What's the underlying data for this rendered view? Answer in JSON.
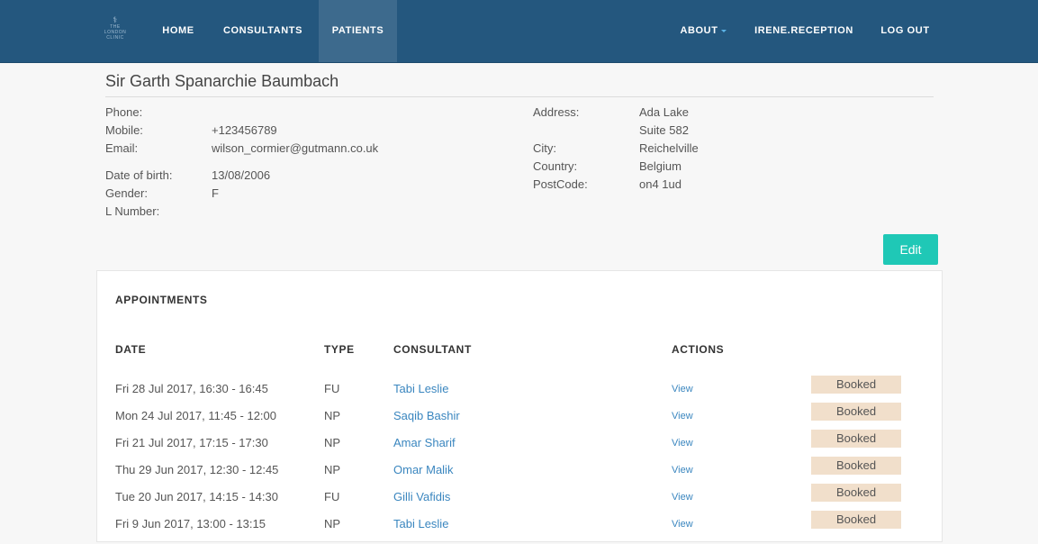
{
  "nav": {
    "logo": {
      "the": "THE",
      "line1": "LONDON",
      "line2": "CLINIC"
    },
    "home": "HOME",
    "consultants": "CONSULTANTS",
    "patients": "PATIENTS",
    "about": "ABOUT",
    "user": "IRENE.RECEPTION",
    "logout": "LOG OUT"
  },
  "patient": {
    "name": "Sir Garth Spanarchie Baumbach",
    "labels": {
      "phone": "Phone:",
      "mobile": "Mobile:",
      "email": "Email:",
      "dob": "Date of birth:",
      "gender": "Gender:",
      "lnumber": "L Number:",
      "address": "Address:",
      "city": "City:",
      "country": "Country:",
      "postcode": "PostCode:"
    },
    "phone": "",
    "mobile": "+123456789",
    "email": "wilson_cormier@gutmann.co.uk",
    "dob": "13/08/2006",
    "gender": "F",
    "lnumber": "",
    "address_line1": "Ada Lake",
    "address_line2": "Suite 582",
    "city": "Reichelville",
    "country": "Belgium",
    "postcode": "on4 1ud"
  },
  "edit_label": "Edit",
  "appointments": {
    "title": "APPOINTMENTS",
    "headers": {
      "date": "DATE",
      "type": "TYPE",
      "consultant": "CONSULTANT",
      "actions": "ACTIONS"
    },
    "rows": [
      {
        "date": "Fri 28 Jul 2017, 16:30 - 16:45",
        "type": "FU",
        "consultant": "Tabi Leslie",
        "action": "View",
        "status": "Booked"
      },
      {
        "date": "Mon 24 Jul 2017, 11:45 - 12:00",
        "type": "NP",
        "consultant": "Saqib Bashir",
        "action": "View",
        "status": "Booked"
      },
      {
        "date": "Fri 21 Jul 2017, 17:15 - 17:30",
        "type": "NP",
        "consultant": "Amar Sharif",
        "action": "View",
        "status": "Booked"
      },
      {
        "date": "Thu 29 Jun 2017, 12:30 - 12:45",
        "type": "NP",
        "consultant": "Omar Malik",
        "action": "View",
        "status": "Booked"
      },
      {
        "date": "Tue 20 Jun 2017, 14:15 - 14:30",
        "type": "FU",
        "consultant": "Gilli Vafidis",
        "action": "View",
        "status": "Booked"
      },
      {
        "date": "Fri 9 Jun 2017, 13:00 - 13:15",
        "type": "NP",
        "consultant": "Tabi Leslie",
        "action": "View",
        "status": "Booked"
      }
    ]
  },
  "colors": {
    "navbar": "#24577e",
    "active_tab": "#3d6a8d",
    "edit_button": "#1fc8b6",
    "link": "#3a86bf",
    "status_badge": "#f1dfcb"
  }
}
